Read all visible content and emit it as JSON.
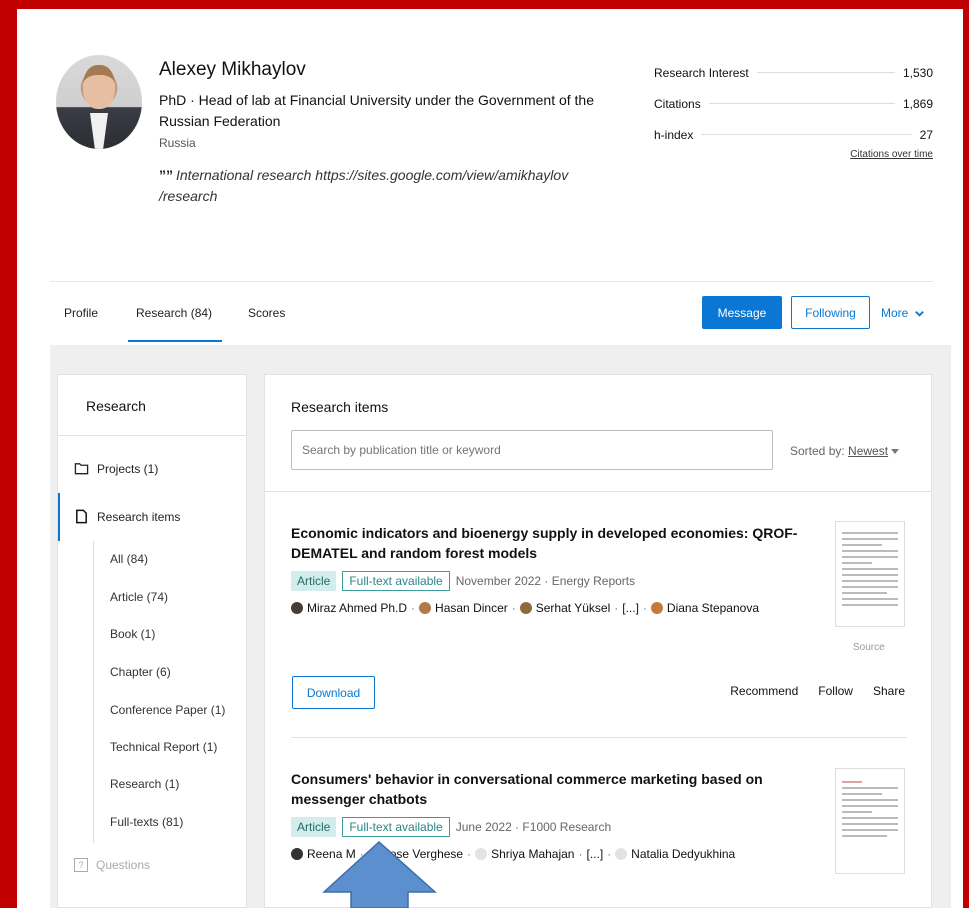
{
  "profile": {
    "name": "Alexey Mikhaylov",
    "position_line": "PhD · Head of lab at Financial University under the Government of the Russian Federation",
    "country": "Russia",
    "quote_mark": "”",
    "quote": "International research https://sites.google.com/view/amikhaylov /research"
  },
  "stats": {
    "rows": [
      {
        "label": "Research Interest",
        "value": "1,530"
      },
      {
        "label": "Citations",
        "value": "1,869"
      },
      {
        "label": "h-index",
        "value": "27"
      }
    ],
    "citations_link": "Citations over time"
  },
  "tabs": {
    "profile": "Profile",
    "research": "Research (84)",
    "scores": "Scores",
    "active": "research"
  },
  "actions": {
    "message": "Message",
    "following": "Following",
    "more": "More"
  },
  "sidebar": {
    "title": "Research",
    "projects": "Projects (1)",
    "research_items": "Research items",
    "sub": [
      "All (84)",
      "Article (74)",
      "Book (1)",
      "Chapter (6)",
      "Conference Paper (1)",
      "Technical Report (1)",
      "Research (1)",
      "Full-texts (81)"
    ],
    "questions": "Questions",
    "questions_icon": "?"
  },
  "main": {
    "title": "Research items",
    "search_placeholder": "Search by publication title or keyword",
    "sorted_label": "Sorted by:",
    "sorted_value": "Newest"
  },
  "items": [
    {
      "title": "Economic indicators and bioenergy supply in developed economies: QROF-DEMATEL and random forest models",
      "type": "Article",
      "fulltext": "Full-text available",
      "meta": "November 2022 · Energy Reports",
      "authors": [
        "Miraz Ahmed Ph.D",
        "Hasan Dincer",
        "Serhat Yüksel",
        "[...]",
        "Diana Stepanova"
      ],
      "source": "Source",
      "download": "Download",
      "recommend": "Recommend",
      "follow": "Follow",
      "share": "Share"
    },
    {
      "title": "Consumers' behavior in conversational commerce marketing based on messenger chatbots",
      "type": "Article",
      "fulltext": "Full-text available",
      "meta": "June 2022 · F1000 Research",
      "authors": [
        "Reena M",
        "Jose Verghese",
        "Shriya Mahajan",
        "[...]",
        "Natalia Dedyukhina"
      ]
    }
  ],
  "colors": {
    "frame": "#c00000",
    "accent": "#0a77d5",
    "arrow": "#5b8fce"
  }
}
